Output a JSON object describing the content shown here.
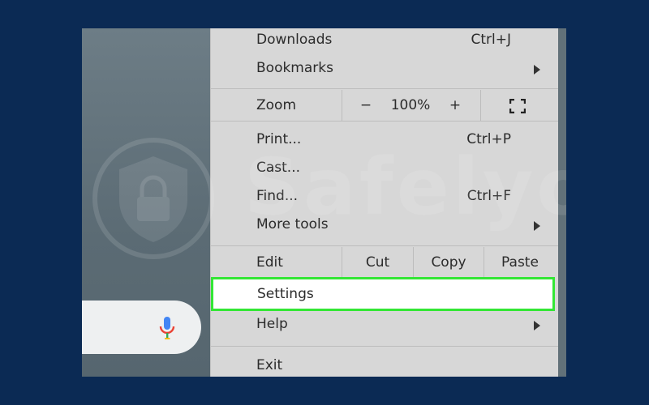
{
  "menu": {
    "downloads": {
      "label": "Downloads",
      "shortcut": "Ctrl+J"
    },
    "bookmarks": {
      "label": "Bookmarks"
    },
    "zoom": {
      "label": "Zoom",
      "minus": "−",
      "value": "100%",
      "plus": "+"
    },
    "print": {
      "label": "Print...",
      "shortcut": "Ctrl+P"
    },
    "cast": {
      "label": "Cast..."
    },
    "find": {
      "label": "Find...",
      "shortcut": "Ctrl+F"
    },
    "more_tools": {
      "label": "More tools"
    },
    "edit": {
      "label": "Edit",
      "cut": "Cut",
      "copy": "Copy",
      "paste": "Paste"
    },
    "settings": {
      "label": "Settings"
    },
    "help": {
      "label": "Help"
    },
    "exit": {
      "label": "Exit"
    }
  },
  "watermark": {
    "text": "Safelyo"
  },
  "colors": {
    "page_background": "#0b2a54",
    "menu_background": "#d7d7d7",
    "highlight_border": "#33e635",
    "mic_blue": "#4285f4",
    "mic_red": "#ea4335"
  },
  "icons": {
    "fullscreen": "fullscreen-icon",
    "submenu": "chevron-right-icon",
    "mic": "microphone-icon",
    "watermark": "shield-lock-icon"
  }
}
